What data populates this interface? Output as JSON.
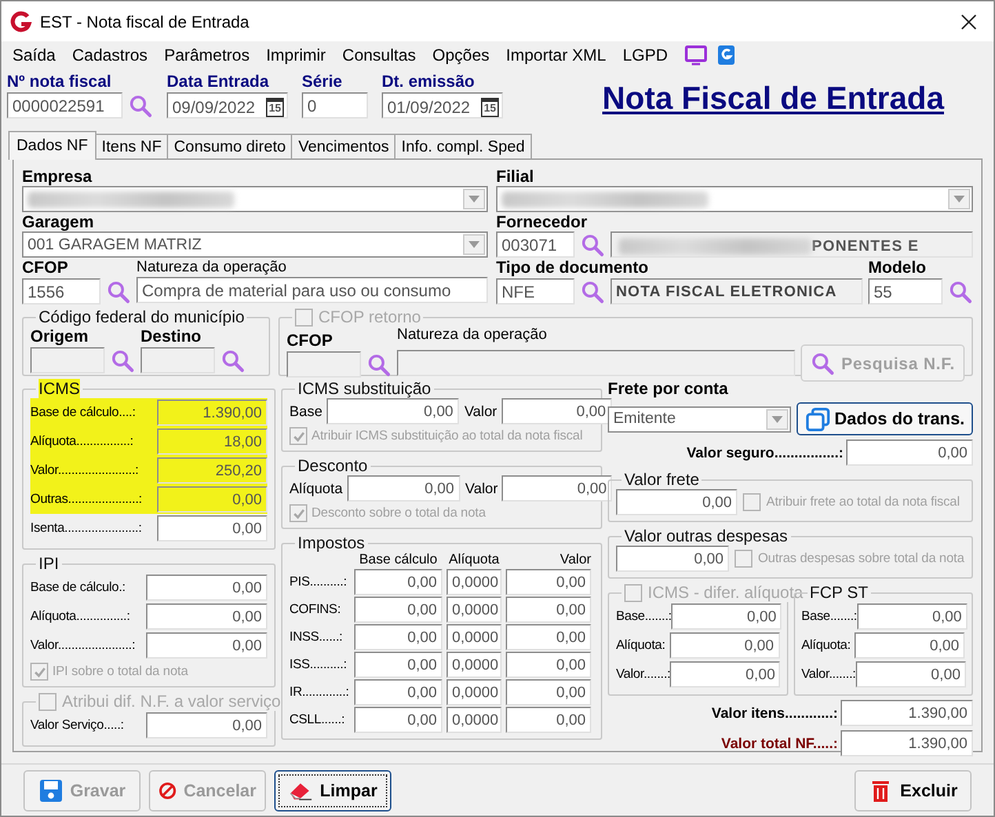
{
  "window": {
    "title": "EST - Nota fiscal de Entrada"
  },
  "menu": [
    {
      "label": "Saída"
    },
    {
      "label": "Cadastros"
    },
    {
      "label": "Parâmetros"
    },
    {
      "label": "Imprimir"
    },
    {
      "label": "Consultas"
    },
    {
      "label": "Opções"
    },
    {
      "label": "Importar XML"
    },
    {
      "label": "LGPD"
    }
  ],
  "header": {
    "fields": [
      {
        "kind": "search",
        "label": "Nº nota fiscal",
        "value": "0000022591"
      },
      {
        "kind": "date",
        "label": "Data Entrada",
        "value": "09/09/2022",
        "calendar": "15"
      },
      {
        "kind": "plain",
        "label": "Série",
        "value": "0"
      },
      {
        "kind": "date",
        "label": "Dt. emissão",
        "value": "01/09/2022",
        "calendar": "15"
      }
    ],
    "heading": "Nota Fiscal de Entrada"
  },
  "tabs": [
    {
      "label": "Dados NF",
      "selected": true
    },
    {
      "label": "Itens NF",
      "selected": false
    },
    {
      "label": "Consumo direto",
      "selected": false
    },
    {
      "label": "Vencimentos",
      "selected": false
    },
    {
      "label": "Info. compl. Sped",
      "selected": false
    }
  ],
  "empresa": {
    "label": "Empresa",
    "blurred": true
  },
  "filial": {
    "label": "Filial",
    "blurred": true
  },
  "garagem": {
    "label": "Garagem",
    "value": "001 GARAGEM MATRIZ"
  },
  "fornecedor": {
    "label": "Fornecedor",
    "code": "003071",
    "name": "PONENTES E",
    "blurred": true
  },
  "cfop": {
    "label": "CFOP",
    "value": "1556"
  },
  "natureza": {
    "label": "Natureza da operação",
    "value": "Compra de material para uso ou consumo"
  },
  "tipo_documento": {
    "label": "Tipo de documento",
    "code": "NFE",
    "name": "NOTA FISCAL ELETRONICA"
  },
  "modelo": {
    "label": "Modelo",
    "value": "55"
  },
  "municipio": {
    "title": "Código federal do município",
    "origem_label": "Origem",
    "destino_label": "Destino"
  },
  "cfop_retorno": {
    "title": "CFOP retorno",
    "checked": false,
    "cfop_label": "CFOP",
    "natureza_label": "Natureza da operação",
    "button": "Pesquisa N.F."
  },
  "icms": {
    "title": "ICMS",
    "highlighted": true,
    "rows": [
      {
        "label": "Base de cálculo....:",
        "value": "1.390,00",
        "highlighted": true
      },
      {
        "label": "Alíquota................:",
        "value": "18,00",
        "highlighted": true
      },
      {
        "label": "Valor.......................:",
        "value": "250,20",
        "highlighted": true
      },
      {
        "label": "Outras.....................:",
        "value": "0,00",
        "highlighted": true
      },
      {
        "label": "Isenta......................:",
        "value": "0,00",
        "highlighted": false
      }
    ]
  },
  "ipi": {
    "title": "IPI",
    "rows": [
      {
        "label": "Base de cálculo.:",
        "value": "0,00"
      },
      {
        "label": "Alíquota...............:",
        "value": "0,00"
      },
      {
        "label": "Valor......................:",
        "value": "0,00"
      }
    ],
    "checkbox": {
      "label": "IPI sobre o total da nota",
      "checked": true
    }
  },
  "servico": {
    "title": "Atribui dif. N.F. a valor serviço",
    "checked": false,
    "label": "Valor Serviço.....:",
    "value": "0,00"
  },
  "icms_st": {
    "title": "ICMS substituição",
    "base_label": "Base",
    "base": "0,00",
    "valor_label": "Valor",
    "valor": "0,00",
    "checkbox": {
      "label": "Atribuir ICMS substituição ao total da nota fiscal",
      "checked": true
    }
  },
  "desconto": {
    "title": "Desconto",
    "aliquota_label": "Alíquota",
    "aliquota": "0,00",
    "valor_label": "Valor",
    "valor": "0,00",
    "checkbox": {
      "label": "Desconto sobre o total da nota",
      "checked": true
    }
  },
  "impostos": {
    "title": "Impostos",
    "columns": [
      "Base cálculo",
      "Alíquota",
      "Valor"
    ],
    "rows": [
      {
        "label": "PIS..........:",
        "values": [
          "0,00",
          "0,0000",
          "0,00"
        ]
      },
      {
        "label": "COFINS:",
        "values": [
          "0,00",
          "0,0000",
          "0,00"
        ]
      },
      {
        "label": "INSS......:",
        "values": [
          "0,00",
          "0,0000",
          "0,00"
        ]
      },
      {
        "label": "ISS..........:",
        "values": [
          "0,00",
          "0,0000",
          "0,00"
        ]
      },
      {
        "label": "IR.............:",
        "values": [
          "0,00",
          "0,0000",
          "0,00"
        ]
      },
      {
        "label": "CSLL......:",
        "values": [
          "0,00",
          "0,0000",
          "0,00"
        ]
      }
    ]
  },
  "frete": {
    "label": "Frete por conta",
    "value": "Emitente",
    "button": "Dados do trans.",
    "seguro_label": "Valor seguro................:",
    "seguro": "0,00"
  },
  "valor_frete": {
    "title": "Valor frete",
    "value": "0,00",
    "checkbox": {
      "label": "Atribuir frete ao total da nota fiscal",
      "checked": false
    }
  },
  "outras_despesas": {
    "title": "Valor outras despesas",
    "value": "0,00",
    "checkbox": {
      "label": "Outras despesas sobre total da nota",
      "checked": false
    }
  },
  "icms_difal": {
    "title": "ICMS - difer. alíquota",
    "checked": false,
    "rows": [
      {
        "label": "Base.......:",
        "value": "0,00"
      },
      {
        "label": "Alíquota:",
        "value": "0,00"
      },
      {
        "label": "Valor.......:",
        "value": "0,00"
      }
    ]
  },
  "fcp_st": {
    "title": "FCP ST",
    "rows": [
      {
        "label": "Base.......:",
        "value": "0,00"
      },
      {
        "label": "Alíquota:",
        "value": "0,00"
      },
      {
        "label": "Valor.......:",
        "value": "0,00"
      }
    ]
  },
  "totals": [
    {
      "kind": "items",
      "label": "Valor itens............:",
      "value": "1.390,00"
    },
    {
      "kind": "total",
      "label": "Valor total NF.....:",
      "value": "1.390,00"
    }
  ],
  "buttons": [
    {
      "kind": "save",
      "label": "Gravar",
      "disabled": true,
      "focused": false
    },
    {
      "kind": "cancel",
      "label": "Cancelar",
      "disabled": true,
      "focused": false
    },
    {
      "kind": "clear",
      "label": "Limpar",
      "disabled": false,
      "focused": true
    },
    {
      "kind": "delete",
      "label": "Excluir",
      "disabled": false,
      "focused": false
    }
  ]
}
